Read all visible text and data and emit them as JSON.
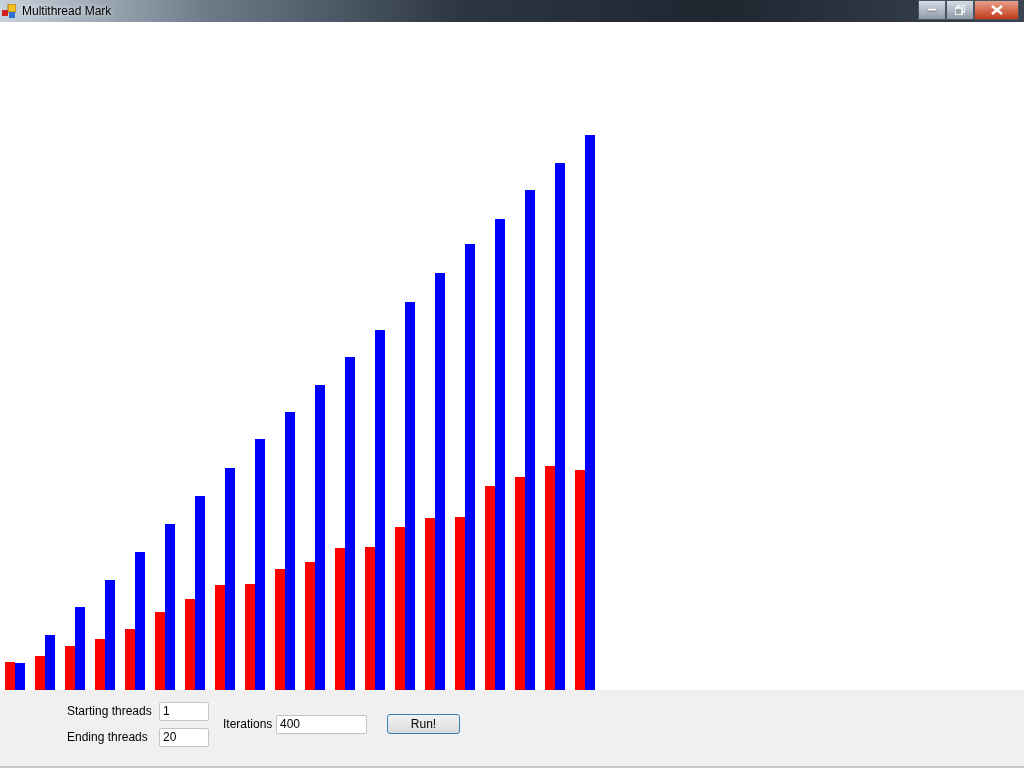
{
  "window": {
    "title": "Multithread Mark"
  },
  "fields": [
    {
      "label": "Starting threads",
      "value": "1"
    },
    {
      "label": "Ending threads",
      "value": "20"
    }
  ],
  "iterations": {
    "label": "Iterations",
    "value": "400"
  },
  "buttons": [
    "Run!"
  ]
}
